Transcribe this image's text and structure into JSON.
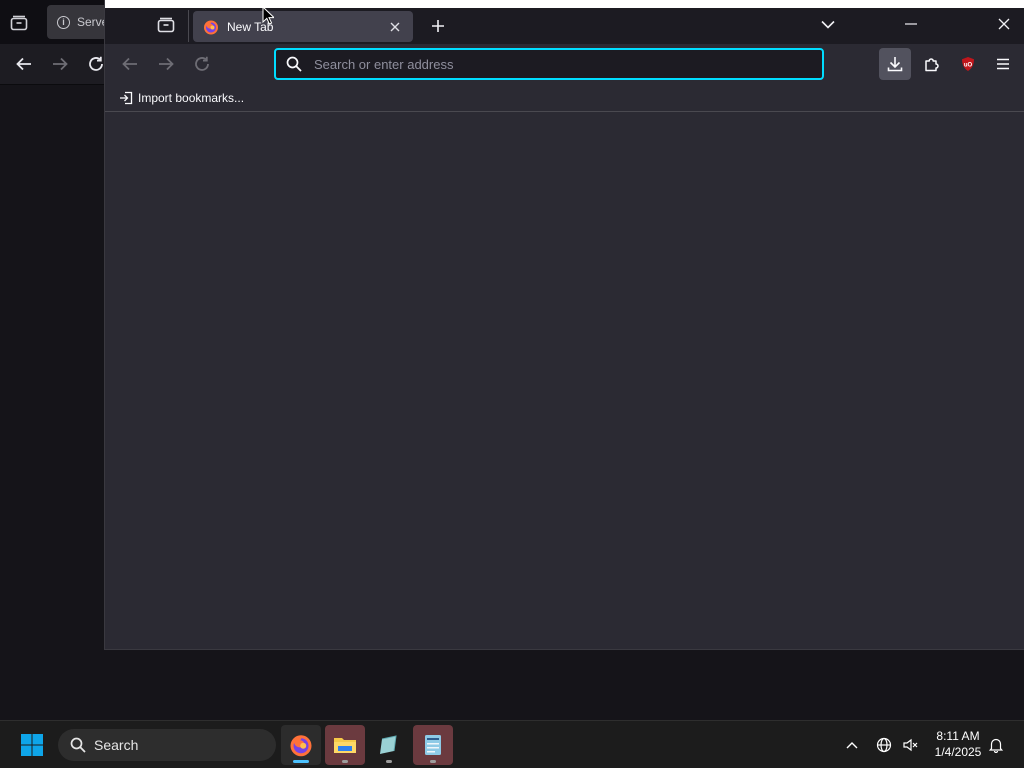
{
  "background_window": {
    "tab_title": "Serve"
  },
  "browser": {
    "active_tab": {
      "title": "New Tab"
    },
    "urlbar": {
      "placeholder": "Search or enter address",
      "value": ""
    },
    "bookmarks_toolbar": {
      "import_label": "Import bookmarks..."
    },
    "addon_badge": "uO"
  },
  "taskbar": {
    "search_label": "Search",
    "clock": {
      "time": "8:11 AM",
      "date": "1/4/2025"
    }
  },
  "colors": {
    "accent": "#00ddff",
    "addon_red": "#c0161c",
    "taskbar_bg": "#1c1c1c",
    "windows_blue": "#0ea5e9"
  }
}
